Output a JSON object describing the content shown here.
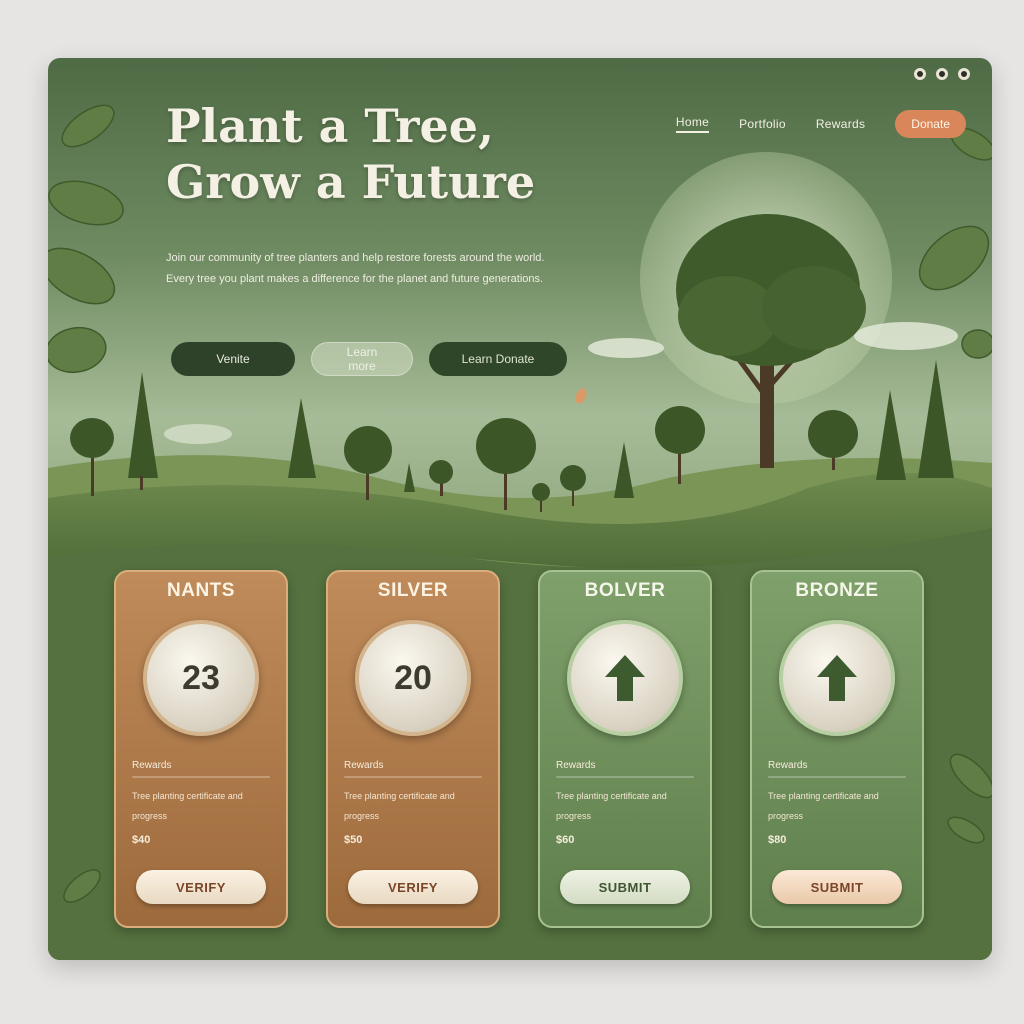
{
  "hero": {
    "title_line1": "Plant a Tree,",
    "title_line2": "Grow a Future",
    "description": "Join our community of tree planters and help restore forests around the world. Every tree you plant makes a difference for the planet and future generations.",
    "buttons": [
      "Venite",
      "Learn more",
      "Learn Donate"
    ]
  },
  "nav": {
    "items": [
      "Home",
      "Portfolio",
      "Rewards"
    ],
    "active_index": 0,
    "donate_label": "Donate"
  },
  "tiers": [
    {
      "title": "NANTS",
      "badge_value": "23",
      "badge_icon": "",
      "label": "Rewards",
      "desc": "Tree planting certificate and progress",
      "price": "$40",
      "button": "VERIFY",
      "style": "copper"
    },
    {
      "title": "SILVER",
      "badge_value": "20",
      "badge_icon": "",
      "label": "Rewards",
      "desc": "Tree planting certificate and progress",
      "price": "$50",
      "button": "VERIFY",
      "style": "copper"
    },
    {
      "title": "BOLVER",
      "badge_value": "",
      "badge_icon": "arrow-up-icon",
      "label": "Rewards",
      "desc": "Tree planting certificate and progress",
      "price": "$60",
      "button": "SUBMIT",
      "style": "green"
    },
    {
      "title": "BRONZE",
      "badge_value": "",
      "badge_icon": "arrow-up-icon",
      "label": "Rewards",
      "desc": "Tree planting certificate and progress",
      "price": "$80",
      "button": "SUBMIT",
      "style": "green-alt"
    }
  ],
  "colors": {
    "forest_dark": "#2e4229",
    "accent_orange": "#d9875a",
    "copper": "#b07a48",
    "sage": "#7fa06b"
  }
}
